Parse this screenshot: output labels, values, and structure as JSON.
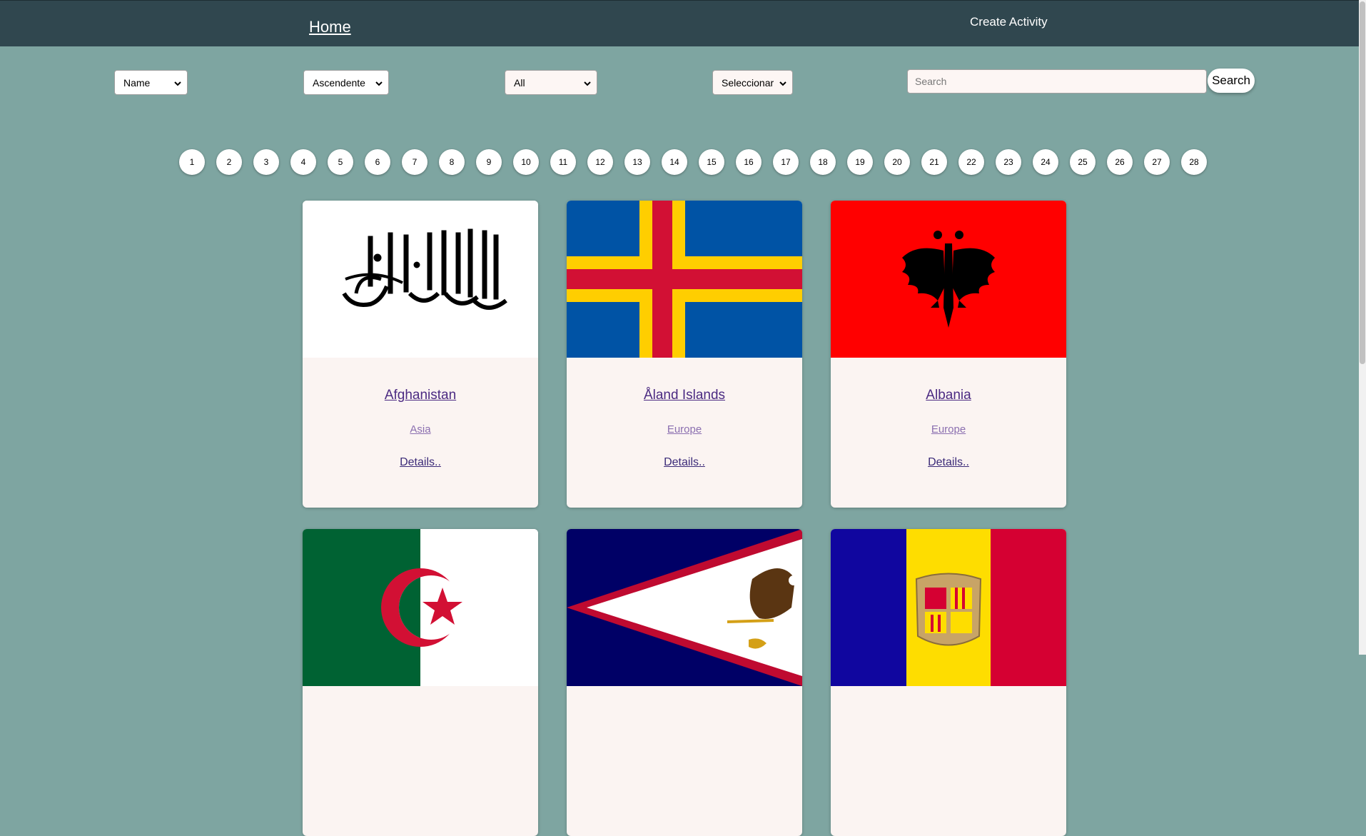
{
  "nav": {
    "home_label": "Home",
    "create_label": "Create Activity"
  },
  "filters": {
    "order_by": "Name",
    "direction": "Ascendente",
    "continent": "All",
    "activity": "Seleccionar"
  },
  "search": {
    "placeholder": "Search",
    "button_label": "Search"
  },
  "pagination": {
    "pages": [
      "1",
      "2",
      "3",
      "4",
      "5",
      "6",
      "7",
      "8",
      "9",
      "10",
      "11",
      "12",
      "13",
      "14",
      "15",
      "16",
      "17",
      "18",
      "19",
      "20",
      "21",
      "22",
      "23",
      "24",
      "25",
      "26",
      "27",
      "28"
    ]
  },
  "cards": [
    {
      "name": "Afghanistan",
      "continent": "Asia",
      "details": "Details.."
    },
    {
      "name": "Åland Islands",
      "continent": "Europe",
      "details": "Details.."
    },
    {
      "name": "Albania",
      "continent": "Europe",
      "details": "Details.."
    }
  ],
  "colors": {
    "background": "#7ea5a1",
    "navbar": "#30474f",
    "card": "#fbf4f2",
    "link": "#4b2a82"
  }
}
